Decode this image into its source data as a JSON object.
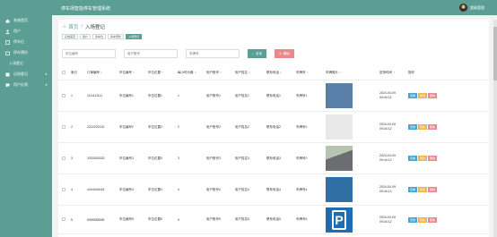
{
  "header": {
    "title": "停车场智能停车管理系统",
    "user": "超级管理"
  },
  "sidebar": {
    "items": [
      {
        "label": "系统首页",
        "icon": "home-icon"
      },
      {
        "label": "用户",
        "icon": "user-icon"
      },
      {
        "label": "停车位",
        "icon": "parking-icon"
      },
      {
        "label": "停车预约",
        "icon": "calendar-icon"
      },
      {
        "label": "入场登记",
        "icon": "login-icon"
      },
      {
        "label": "出场登记",
        "icon": "logout-icon"
      },
      {
        "label": "用户反馈",
        "icon": "feedback-icon"
      }
    ]
  },
  "breadcrumb": {
    "home": "首页",
    "current": "入场登记"
  },
  "tabs": [
    "系统首页",
    "用户",
    "停车位",
    "停车预约",
    "入场登记"
  ],
  "search": {
    "placeholders": [
      "车位编号",
      "用户账号",
      "车牌号"
    ],
    "search_label": "查询",
    "delete_label": "删除"
  },
  "table": {
    "headers": [
      "索引",
      "订单编号",
      "车位编号",
      "车位位置",
      "每小时价格",
      "用户账号",
      "用户姓名",
      "联系电话",
      "车牌号",
      "车牌照片",
      "进场时间",
      "操作"
    ],
    "rows": [
      {
        "idx": "1",
        "order": "1111111111",
        "pn": "车位编号1",
        "pl": "车位位置1",
        "hr": "1",
        "ua": "用户账号1",
        "un": "用户姓名1",
        "ph": "联系电话1",
        "plate": "车牌号1",
        "time": "2024-04-09 09:44:12"
      },
      {
        "idx": "2",
        "order": "2222222222",
        "pn": "车位编号2",
        "pl": "车位位置2",
        "hr": "2",
        "ua": "用户账号2",
        "un": "用户姓名2",
        "ph": "联系电话2",
        "plate": "车牌号2",
        "time": "2024-04-09 09:44:12"
      },
      {
        "idx": "3",
        "order": "3333333333",
        "pn": "车位编号3",
        "pl": "车位位置3",
        "hr": "3",
        "ua": "用户账号3",
        "un": "用户姓名3",
        "ph": "联系电话3",
        "plate": "车牌号3",
        "time": "2024-04-09 09:44:12"
      },
      {
        "idx": "4",
        "order": "4444444444",
        "pn": "车位编号4",
        "pl": "车位位置4",
        "hr": "4",
        "ua": "用户账号4",
        "un": "用户姓名4",
        "ph": "联系电话4",
        "plate": "车牌号4",
        "time": "2024-04-09 09:44:12"
      },
      {
        "idx": "5",
        "order": "5555555555",
        "pn": "车位编号5",
        "pl": "车位位置5",
        "hr": "5",
        "ua": "用户账号5",
        "un": "用户姓名5",
        "ph": "联系电话5",
        "plate": "车牌号5",
        "time": "2024-04-09 09:44:12"
      }
    ],
    "ops": {
      "view": "查看",
      "edit": "修改",
      "del": "删除"
    },
    "p_letter": "P"
  },
  "colors": {
    "primary": "#5a9e94",
    "danger": "#e98a8a",
    "view": "#3fa6d5",
    "edit": "#f0b34d"
  }
}
